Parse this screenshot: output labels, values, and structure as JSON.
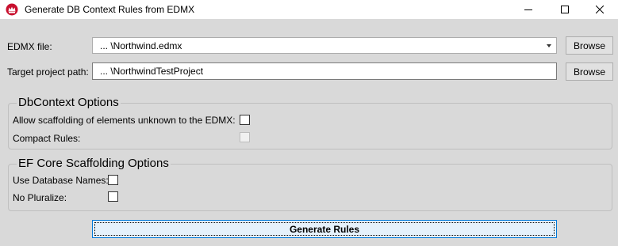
{
  "window": {
    "title": "Generate DB Context Rules from EDMX",
    "controls": [
      "minimize-icon",
      "maximize-icon",
      "close-icon"
    ]
  },
  "edmx": {
    "label": "EDMX file:",
    "value": "...  \\Northwind.edmx",
    "browse_label": "Browse"
  },
  "target": {
    "label": "Target project path:",
    "value": "...  \\NorthwindTestProject",
    "browse_label": "Browse"
  },
  "dbcontext": {
    "title": "DbContext Options",
    "allow_unknown_label": "Allow scaffolding of elements unknown to the EDMX:",
    "allow_unknown_checked": false,
    "compact_rules_label": "Compact Rules:",
    "compact_rules_checked": false,
    "compact_rules_enabled": false
  },
  "efcore": {
    "title": "EF Core Scaffolding Options",
    "use_db_names_label": "Use Database Names:",
    "use_db_names_checked": false,
    "no_pluralize_label": "No Pluralize:",
    "no_pluralize_checked": false
  },
  "generate_label": "Generate Rules",
  "colors": {
    "window_bg": "#d9d9d9",
    "accent": "#0078d7",
    "app_icon": "#c8102e"
  }
}
